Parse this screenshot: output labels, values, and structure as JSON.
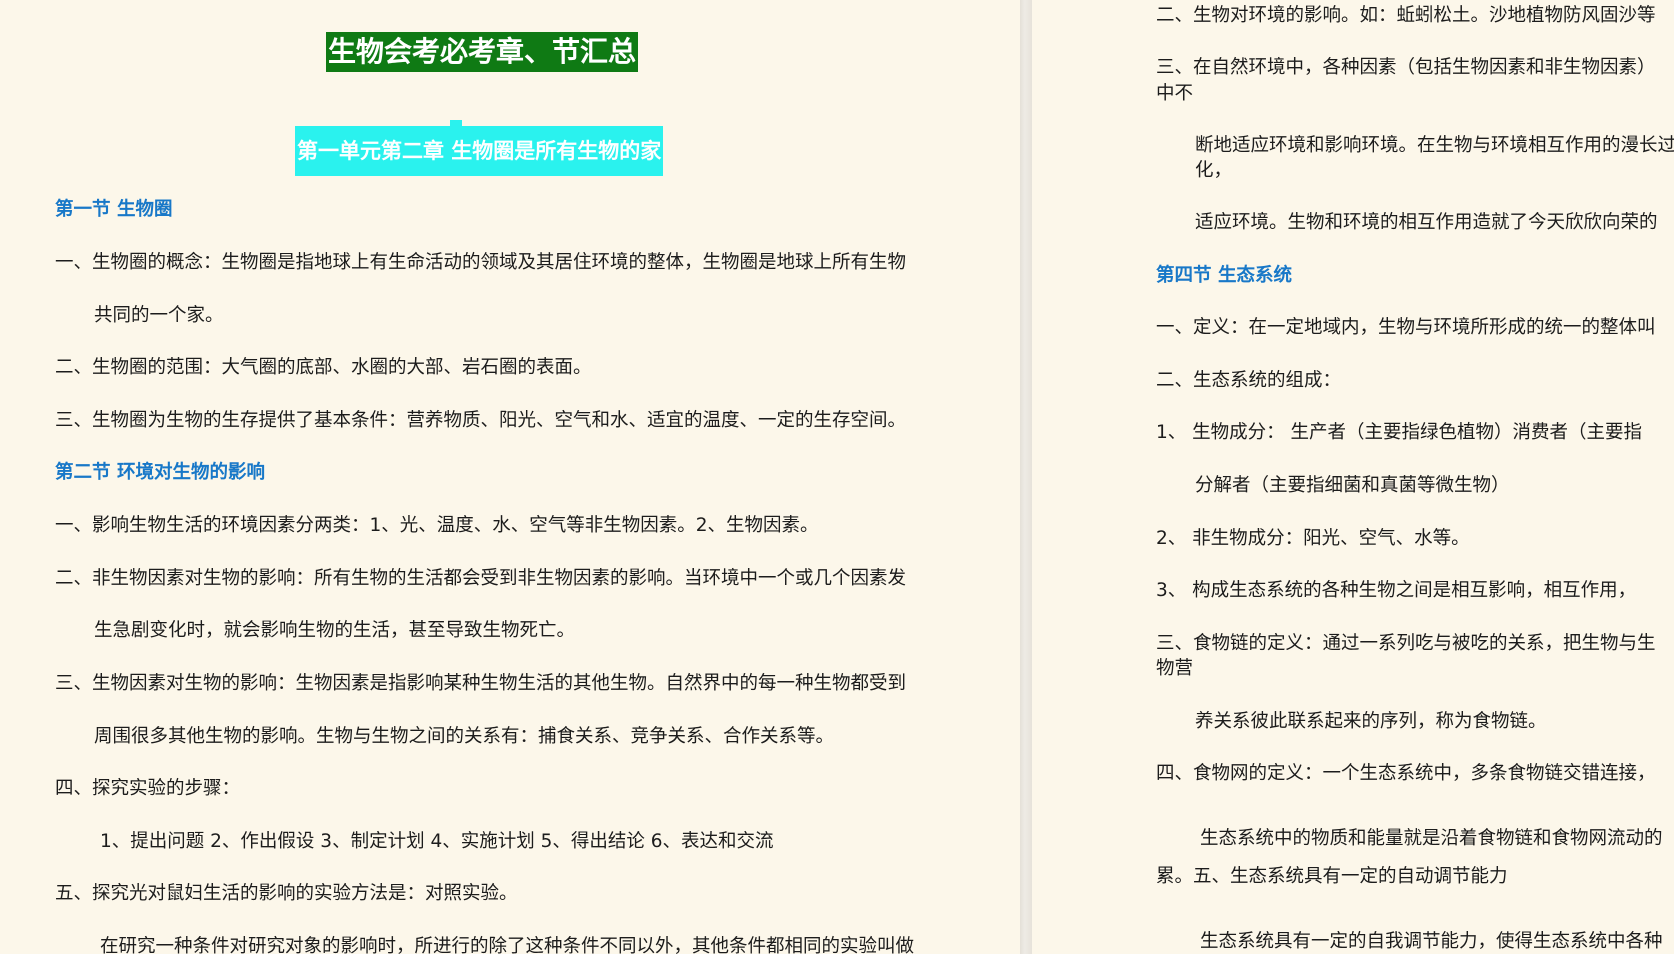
{
  "left_page": {
    "doc_title": "生物会考必考章、节汇总",
    "chapter_title": "第一单元第二章  生物圈是所有生物的家",
    "lines": [
      "第一节   生物圈",
      "一、生物圈的概念：生物圈是指地球上有生命活动的领域及其居住环境的整体，生物圈是地球上所有生物",
      "共同的一个家。",
      "二、生物圈的范围：大气圈的底部、水圈的大部、岩石圈的表面。",
      "三、生物圈为生物的生存提供了基本条件：营养物质、阳光、空气和水、适宜的温度、一定的生存空间。",
      "第二节   环境对生物的影响",
      "一、影响生物生活的环境因素分两类：1、光、温度、水、空气等非生物因素。2、生物因素。",
      "二、非生物因素对生物的影响：所有生物的生活都会受到非生物因素的影响。当环境中一个或几个因素发",
      "生急剧变化时，就会影响生物的生活，甚至导致生物死亡。",
      "三、生物因素对生物的影响：生物因素是指影响某种生物生活的其他生物。自然界中的每一种生物都受到",
      "周围很多其他生物的影响。生物与生物之间的关系有：捕食关系、竞争关系、合作关系等。",
      "四、探究实验的步骤：",
      "1、提出问题 2、作出假设 3、制定计划 4、实施计划 5、得出结论 6、表达和交流",
      "五、探究光对鼠妇生活的影响的实验方法是：对照实验。",
      "在研究一种条件对研究对象的影响时，所进行的除了这种条件不同以外，其他条件都相同的实验叫做"
    ]
  },
  "right_page": {
    "lines": [
      "二、生物对环境的影响。如：蚯蚓松土。沙地植物防风固沙等",
      "三、在自然环境中，各种因素（包括生物因素和非生物因素）",
      "中不",
      "断地适应环境和影响环境。在生物与环境相互作用的漫长过",
      "化，",
      "适应环境。生物和环境的相互作用造就了今天欣欣向荣的",
      "第四节   生态系统",
      "一、定义：在一定地域内，生物与环境所形成的统一的整体叫",
      "二、生态系统的组成：",
      "1、 生物成分： 生产者（主要指绿色植物）消费者（主要指",
      "分解者（主要指细菌和真菌等微生物）",
      "2、 非生物成分：阳光、空气、水等。",
      "3、   构成生态系统的各种生物之间是相互影响，相互作用，",
      "三、食物链的定义：通过一系列吃与被吃的关系，把生物与生",
      "物营",
      "养关系彼此联系起来的序列，称为食物链。",
      "四、食物网的定义：一个生态系统中，多条食物链交错连接，",
      "生态系统中的物质和能量就是沿着食物链和食物网流动的",
      "累。五、生态系统具有一定的自动调节能力",
      "生态系统具有一定的自我调节能力，使得生态系统中各种"
    ]
  },
  "colors": {
    "page_background": "#fcf7ea",
    "title_highlight": "#0f7a14",
    "chapter_highlight": "#2af2ee",
    "section_heading": "#1878c8",
    "body_text": "#1c1c1c"
  }
}
